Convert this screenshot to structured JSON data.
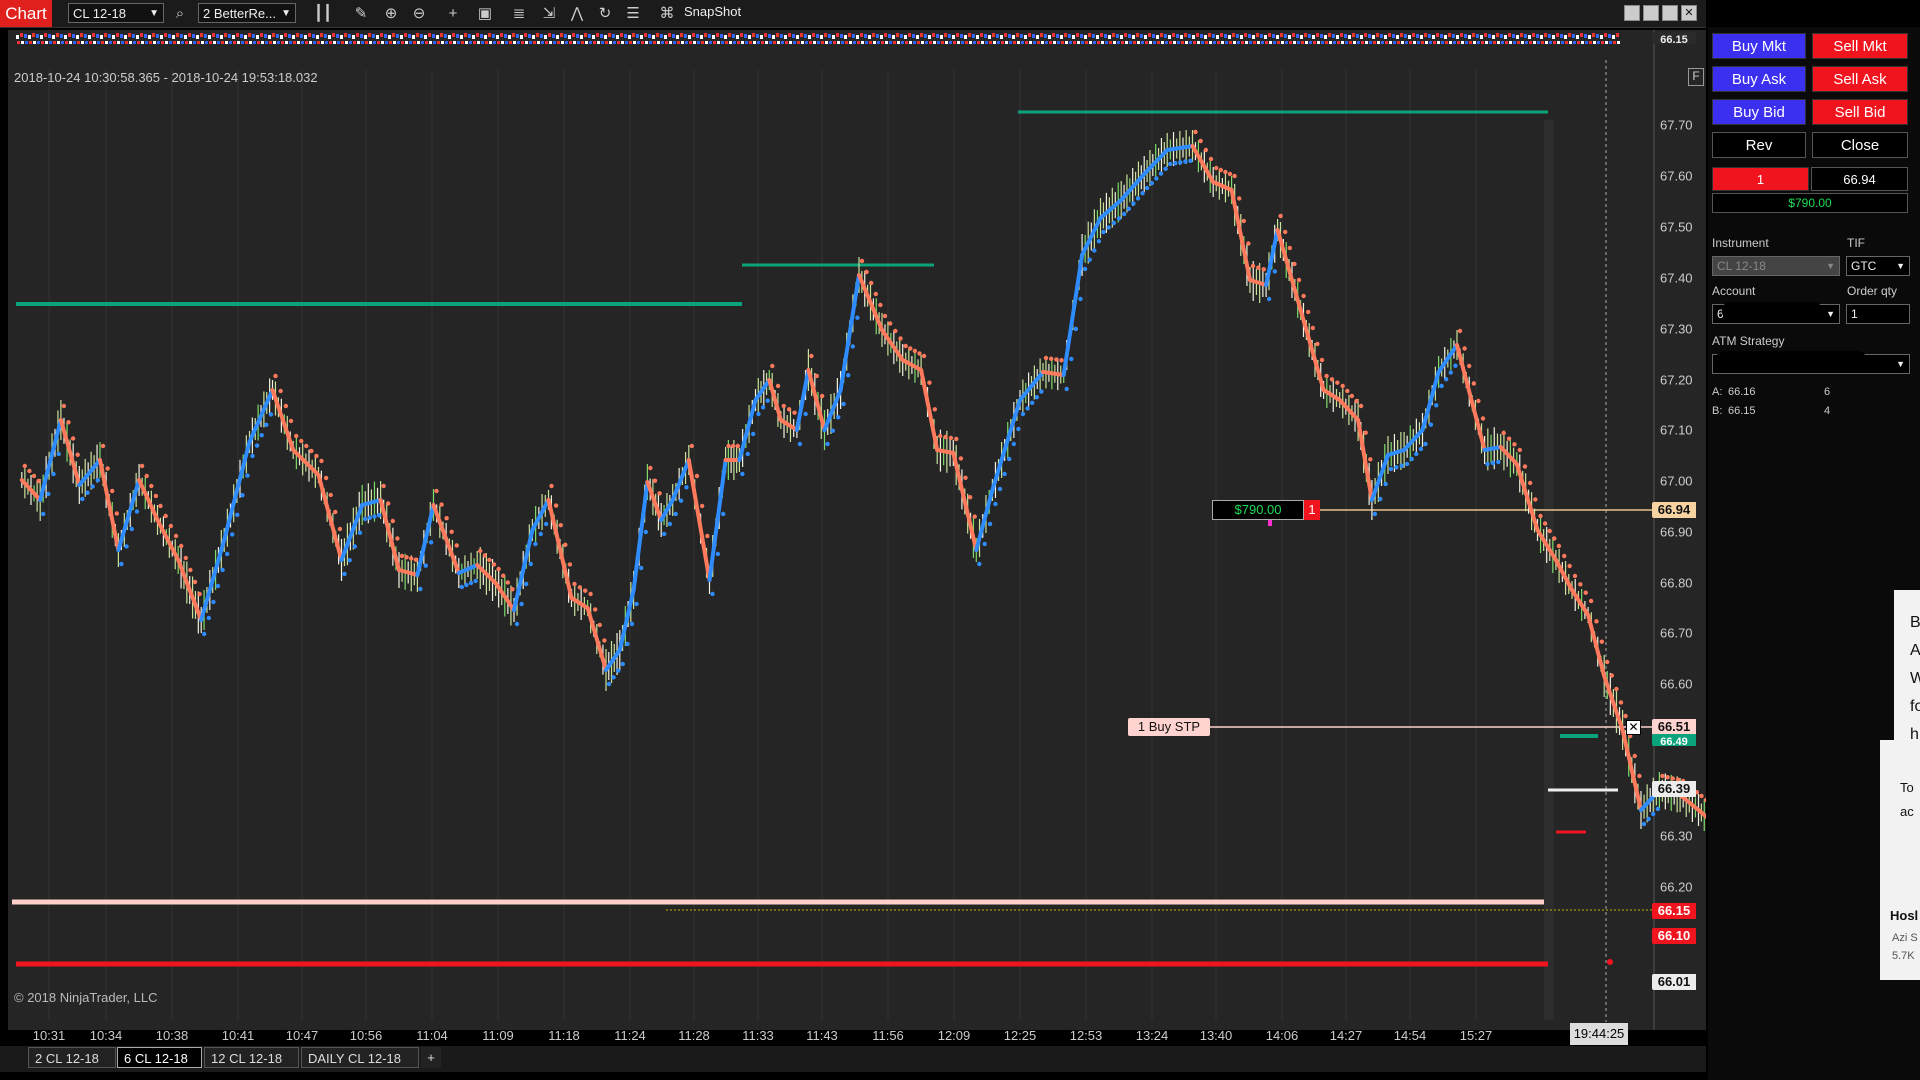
{
  "window": {
    "tab": "Chart"
  },
  "toolbar": {
    "instrument": "CL 12-18",
    "bar_type": "2 BetterRe...",
    "snapshot": "SnapShot"
  },
  "chart": {
    "date_range": "2018-10-24 10:30:58.365 - 2018-10-24 19:53:18.032",
    "copyright": "© 2018 NinjaTrader, LLC",
    "f_button": "F",
    "current_time": "19:44:25",
    "time_labels": [
      "10:31",
      "10:34",
      "10:38",
      "10:41",
      "10:47",
      "10:56",
      "11:04",
      "11:09",
      "11:18",
      "11:24",
      "11:28",
      "11:33",
      "11:43",
      "11:56",
      "12:09",
      "12:25",
      "12:53",
      "13:24",
      "13:40",
      "14:06",
      "14:27",
      "14:54",
      "15:27"
    ],
    "price_labels": [
      "67.70",
      "67.60",
      "67.50",
      "67.40",
      "67.30",
      "67.20",
      "67.10",
      "67.00",
      "66.90",
      "66.80",
      "66.70",
      "66.60",
      "66.30",
      "66.20"
    ],
    "price_tags": {
      "top": "66.15",
      "avg": "66.94",
      "stop": "66.51",
      "upper": "66.49",
      "mid": "66.39",
      "bid": "66.15",
      "last": "66.10",
      "low": "66.01"
    },
    "position_pnl": "$790.00",
    "position_qty": "1",
    "stop_order": "1  Buy STP",
    "close_x": "✕",
    "colors": {
      "up": "#2f8cff",
      "down": "#ff7a5c",
      "teal": "#0aa37b",
      "red": "#f0141e",
      "salmon": "#ffd0c8"
    }
  },
  "bottom_tabs": [
    {
      "label": "2  CL 12-18"
    },
    {
      "label": "6  CL 12-18"
    },
    {
      "label": "12  CL 12-18"
    },
    {
      "label": "DAILY  CL 12-18"
    }
  ],
  "add_tab": "+",
  "order_panel": {
    "buy_mkt": "Buy Mkt",
    "sell_mkt": "Sell Mkt",
    "buy_ask": "Buy Ask",
    "sell_ask": "Sell Ask",
    "buy_bid": "Buy Bid",
    "sell_bid": "Sell Bid",
    "rev": "Rev",
    "close": "Close",
    "position_qty": "1",
    "avg_price": "66.94",
    "pnl": "$790.00",
    "instrument_label": "Instrument",
    "tif_label": "TIF",
    "instrument_value": "CL 12-18",
    "tif_value": "GTC",
    "account_label": "Account",
    "order_qty_label": "Order qty",
    "account_value": "6",
    "order_qty_value": "1",
    "atm_label": "ATM Strategy",
    "ask_label": "A:",
    "ask_price": "66.16",
    "ask_size": "6",
    "bid_label": "B:",
    "bid_price": "66.15",
    "bid_size": "4"
  },
  "right_fragments": {
    "letters": [
      "B",
      "A",
      "W",
      "fo",
      "h"
    ],
    "to": "To",
    "ac": "ac",
    "hosl": "Hosl",
    "azi": "Azi S",
    "views": "5.7K"
  }
}
